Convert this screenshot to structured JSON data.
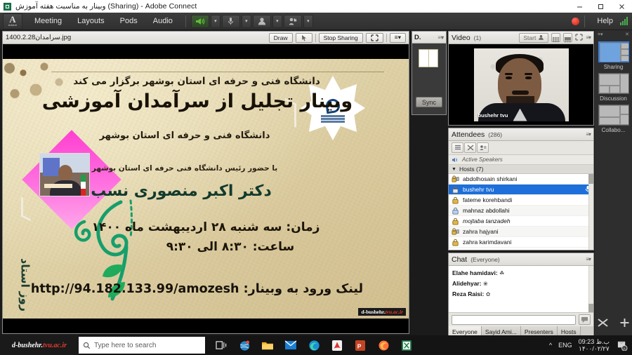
{
  "window": {
    "title": "وبینار به مناسبت هفته آموزش (Sharing) - Adobe Connect",
    "minimize": "minimize-icon",
    "maximize": "maximize-icon",
    "close": "close-icon"
  },
  "menubar": {
    "logo": "adobe-logo",
    "logo_text": "A",
    "logo_sub": "Adobe",
    "items": [
      {
        "label": "Meeting"
      },
      {
        "label": "Layouts"
      },
      {
        "label": "Pods"
      },
      {
        "label": "Audio"
      }
    ],
    "tools": [
      {
        "name": "speaker-icon",
        "state": "active"
      },
      {
        "name": "microphone-icon",
        "state": "idle"
      },
      {
        "name": "webcam-icon",
        "state": "idle"
      },
      {
        "name": "raise-hand-icon",
        "state": "idle"
      }
    ],
    "recording": "recording-indicator",
    "help_label": "Help",
    "signal": "connection-signal-icon"
  },
  "share_pod": {
    "filename": "سرامدان1400.2.28.jpg",
    "draw_label": "Draw",
    "pointer_icon": "pointer-icon",
    "stop_sharing_label": "Stop Sharing",
    "fullscreen_icon": "fullscreen-icon",
    "menu_icon": "pod-menu-icon"
  },
  "poster": {
    "line1": "دانشگاه فنی و حرفه ای استان بوشهر برگزار می کند",
    "title": "وبینار تجلیل از سرآمدان آموزشی",
    "line2": "دانشگاه فنی و حرفه ای استان بوشهر",
    "line3": "با حضور رئیس دانشگاه فنی حرفه ای استان بوشهر",
    "speaker": "دکتر اکبر منصوری نسب",
    "date": "زمان: سه شنبه ۲۸ اردیبهشت ماه ۱۴۰۰",
    "time": "ساعت: ۸:۳۰ الی ۹:۳۰",
    "link": "لینک ورود به وبینار: http://94.182.133.99/amozesh",
    "vertical": "روز استاد",
    "badge_dark": "d-bushehr.",
    "badge_red": "tvu.ac.ir",
    "logo": "university-emblem-icon"
  },
  "doc_pod": {
    "title": "D.",
    "sync_label": "Sync",
    "menu_icon": "pod-menu-icon",
    "page_icon": "document-page-icon"
  },
  "video_pod": {
    "title": "Video",
    "count": "(1)",
    "start_label": "Start",
    "start_icon": "webcam-icon",
    "grid_icon": "grid-layout-icon",
    "single_icon": "single-layout-icon",
    "fullscreen_icon": "fullscreen-icon",
    "menu_icon": "pod-menu-icon",
    "participant_name": "bushehr tvu"
  },
  "attendees_pod": {
    "title": "Attendees",
    "count": "(286)",
    "menu_icon": "pod-menu-icon",
    "tools": [
      {
        "name": "list-view-icon"
      },
      {
        "name": "breakout-rooms-icon"
      },
      {
        "name": "attendee-options-icon"
      }
    ],
    "active_speakers_label": "Active Speakers",
    "active_speakers_icon": "active-speaker-icon",
    "group_label": "Hosts (7)",
    "group_chevron": "chevron-down-icon",
    "rows": [
      {
        "name": "abdolhosain shirkani",
        "role_icon": "host-webcam-icon",
        "selected": false,
        "mic": false
      },
      {
        "name": "bushehr tvu",
        "role_icon": "host-icon",
        "selected": true,
        "mic": true
      },
      {
        "name": "fateme korehbandi",
        "role_icon": "host-icon",
        "selected": false,
        "mic": false
      },
      {
        "name": "mahnaz abdollahi",
        "role_icon": "host-icon",
        "selected": false,
        "mic": false
      },
      {
        "name": "mojtaba tanzadeh",
        "role_icon": "host-icon",
        "selected": false,
        "mic": false
      },
      {
        "name": "zahra hajyani",
        "role_icon": "host-webcam-icon",
        "selected": false,
        "mic": false
      },
      {
        "name": "zahra karimdavani",
        "role_icon": "host-icon",
        "selected": false,
        "mic": false
      }
    ]
  },
  "chat_pod": {
    "title": "Chat",
    "scope": "(Everyone)",
    "menu_icon": "pod-menu-icon",
    "messages": [
      {
        "sender": "Elahe hamidavi:",
        "emoji": "☘"
      },
      {
        "sender": "Alidehyar:",
        "emoji": "❀"
      },
      {
        "sender": "Reza Raisi:",
        "emoji": "✿"
      }
    ],
    "input_value": "",
    "input_placeholder": "",
    "send_icon": "chat-send-icon",
    "tabs": [
      {
        "label": "Everyone",
        "active": true
      },
      {
        "label": "Sayid Ami...",
        "active": false
      },
      {
        "label": "Presenters",
        "active": false
      },
      {
        "label": "Hosts",
        "active": false
      }
    ]
  },
  "layout_bar": {
    "menu_icon": "pod-menu-icon",
    "close_icon": "close-icon",
    "items": [
      {
        "label": "Sharing",
        "active": true
      },
      {
        "label": "Discussion",
        "active": false
      },
      {
        "label": "Collabo...",
        "active": false
      }
    ],
    "shuffle_icon": "shuffle-icon",
    "add_icon": "add-layout-icon"
  },
  "taskbar": {
    "start_dark": "d-bushehr.",
    "start_red": "tvu.ac.ir",
    "search_placeholder": "Type here to search",
    "search_icon": "search-icon",
    "task_view_icon": "task-view-icon",
    "apps": [
      {
        "name": "globe-app-icon"
      },
      {
        "name": "file-explorer-icon"
      },
      {
        "name": "mail-icon"
      },
      {
        "name": "edge-browser-icon"
      },
      {
        "name": "adobe-reader-icon"
      },
      {
        "name": "powerpoint-icon"
      },
      {
        "name": "firefox-icon"
      },
      {
        "name": "excel-icon"
      }
    ],
    "tray_chevron": "show-hidden-icons-icon",
    "language": "ENG",
    "clock_time": "09:23 ب.ظ",
    "clock_date": "۱۴۰۰/۰۲/۲۷",
    "notification_icon": "notification-icon"
  }
}
